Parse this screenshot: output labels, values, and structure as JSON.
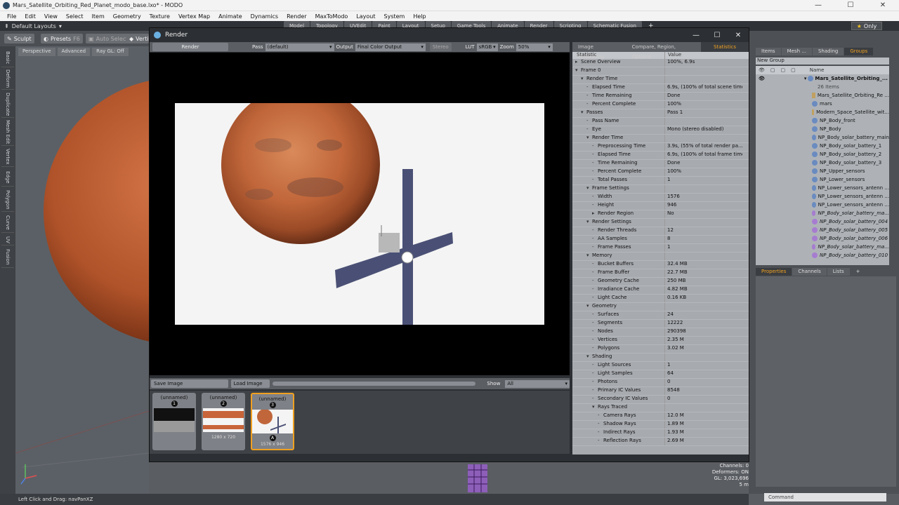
{
  "window": {
    "title": "Mars_Satellite_Orbiting_Red_Planet_modo_base.lxo* - MODO"
  },
  "menu": [
    "File",
    "Edit",
    "View",
    "Select",
    "Item",
    "Geometry",
    "Texture",
    "Vertex Map",
    "Animate",
    "Dynamics",
    "Render",
    "MaxToModo",
    "Layout",
    "System",
    "Help"
  ],
  "layout": {
    "selector": "Default Layouts",
    "tabs": [
      "Model",
      "Topology",
      "UVEdit",
      "Paint",
      "Layout",
      "Setup",
      "Game Tools",
      "Animate",
      "Render",
      "Scripting",
      "Schematic Fusion"
    ],
    "add": "+",
    "only": "Only"
  },
  "toolrow": {
    "sculpt": "Sculpt",
    "presets": "Presets",
    "presets_key": "F6",
    "auto_select": "Auto Select",
    "verts": "Verti"
  },
  "viewport": {
    "tabs": [
      "Perspective",
      "Advanced",
      "Ray GL: Off"
    ]
  },
  "left_tabs": [
    "Basic",
    "Deform",
    "Duplicate",
    "Mesh Edit",
    "Vertex",
    "Edge",
    "Polygon",
    "Curve",
    "UV",
    "Fusion"
  ],
  "render_window": {
    "title": "Render",
    "render_button": "Render",
    "pass_label": "Pass",
    "pass_value": "(default)",
    "output_label": "Output",
    "output_value": "Final Color Output",
    "stereo": "Stereo",
    "lut_label": "LUT",
    "lut_value": "sRGB",
    "zoom_label": "Zoom",
    "zoom_value": "50%",
    "save_image": "Save Image",
    "load_image": "Load Image",
    "show_label": "Show",
    "show_value": "All",
    "thumbs": [
      {
        "name": "(unnamed)",
        "num": "1",
        "size": ""
      },
      {
        "name": "(unnamed)",
        "num": "2",
        "size": "1280 x 720"
      },
      {
        "name": "(unnamed)",
        "num": "3",
        "size": "1576 x 946",
        "badge": "A"
      }
    ]
  },
  "stats": {
    "tabs": [
      "Image Processing",
      "Compare, Region, Options",
      "Statistics"
    ],
    "headers": [
      "Statistic",
      "Value"
    ],
    "rows": [
      {
        "k": "Scene Overview",
        "v": "100%, 6.9s",
        "lvl": 0,
        "arr": "▸"
      },
      {
        "k": "Frame 0",
        "v": "",
        "lvl": 0,
        "arr": "▾"
      },
      {
        "k": "Render Time",
        "v": "",
        "lvl": 1,
        "arr": "▾"
      },
      {
        "k": "Elapsed Time",
        "v": "6.9s, (100% of total scene time)",
        "lvl": 2,
        "arr": "-"
      },
      {
        "k": "Time Remaining",
        "v": "Done",
        "lvl": 2,
        "arr": "-"
      },
      {
        "k": "Percent Complete",
        "v": "100%",
        "lvl": 2,
        "arr": "-"
      },
      {
        "k": "Passes",
        "v": "Pass 1",
        "lvl": 1,
        "arr": "▾"
      },
      {
        "k": "Pass Name",
        "v": "",
        "lvl": 2,
        "arr": "-"
      },
      {
        "k": "Eye",
        "v": "Mono (stereo disabled)",
        "lvl": 2,
        "arr": "-"
      },
      {
        "k": "Render Time",
        "v": "",
        "lvl": 2,
        "arr": "▾"
      },
      {
        "k": "Preprocessing Time",
        "v": "3.9s, (55% of total render pa...",
        "lvl": 3,
        "arr": "-"
      },
      {
        "k": "Elapsed Time",
        "v": "6.9s, (100% of total frame time)",
        "lvl": 3,
        "arr": "-"
      },
      {
        "k": "Time Remaining",
        "v": "Done",
        "lvl": 3,
        "arr": "-"
      },
      {
        "k": "Percent Complete",
        "v": "100%",
        "lvl": 3,
        "arr": "-"
      },
      {
        "k": "Total Passes",
        "v": "1",
        "lvl": 3,
        "arr": "-"
      },
      {
        "k": "Frame Settings",
        "v": "",
        "lvl": 2,
        "arr": "▾"
      },
      {
        "k": "Width",
        "v": "1576",
        "lvl": 3,
        "arr": "-"
      },
      {
        "k": "Height",
        "v": "946",
        "lvl": 3,
        "arr": "-"
      },
      {
        "k": "Render Region",
        "v": "No",
        "lvl": 3,
        "arr": "▸"
      },
      {
        "k": "Render Settings",
        "v": "",
        "lvl": 2,
        "arr": "▾"
      },
      {
        "k": "Render Threads",
        "v": "12",
        "lvl": 3,
        "arr": "-"
      },
      {
        "k": "AA Samples",
        "v": "8",
        "lvl": 3,
        "arr": "-"
      },
      {
        "k": "Frame Passes",
        "v": "1",
        "lvl": 3,
        "arr": "-"
      },
      {
        "k": "Memory",
        "v": "",
        "lvl": 2,
        "arr": "▾"
      },
      {
        "k": "Bucket Buffers",
        "v": "32.4 MB",
        "lvl": 3,
        "arr": "-"
      },
      {
        "k": "Frame Buffer",
        "v": "22.7 MB",
        "lvl": 3,
        "arr": "-"
      },
      {
        "k": "Geometry Cache",
        "v": "250 MB",
        "lvl": 3,
        "arr": "-"
      },
      {
        "k": "Irradiance Cache",
        "v": "4.82 MB",
        "lvl": 3,
        "arr": "-"
      },
      {
        "k": "Light Cache",
        "v": "0.16 KB",
        "lvl": 3,
        "arr": "-"
      },
      {
        "k": "Geometry",
        "v": "",
        "lvl": 2,
        "arr": "▾"
      },
      {
        "k": "Surfaces",
        "v": "24",
        "lvl": 3,
        "arr": "-"
      },
      {
        "k": "Segments",
        "v": "12222",
        "lvl": 3,
        "arr": "-"
      },
      {
        "k": "Nodes",
        "v": "290398",
        "lvl": 3,
        "arr": "-"
      },
      {
        "k": "Vertices",
        "v": "2.35 M",
        "lvl": 3,
        "arr": "-"
      },
      {
        "k": "Polygons",
        "v": "3.02 M",
        "lvl": 3,
        "arr": "-"
      },
      {
        "k": "Shading",
        "v": "",
        "lvl": 2,
        "arr": "▾"
      },
      {
        "k": "Light Sources",
        "v": "1",
        "lvl": 3,
        "arr": "-"
      },
      {
        "k": "Light Samples",
        "v": "64",
        "lvl": 3,
        "arr": "-"
      },
      {
        "k": "Photons",
        "v": "0",
        "lvl": 3,
        "arr": "-"
      },
      {
        "k": "Primary IC Values",
        "v": "8548",
        "lvl": 3,
        "arr": "-"
      },
      {
        "k": "Secondary IC Values",
        "v": "0",
        "lvl": 3,
        "arr": "-"
      },
      {
        "k": "Rays Traced",
        "v": "",
        "lvl": 3,
        "arr": "▾"
      },
      {
        "k": "Camera Rays",
        "v": "12.0 M",
        "lvl": 4,
        "arr": "-"
      },
      {
        "k": "Shadow Rays",
        "v": "1.89 M",
        "lvl": 4,
        "arr": "-"
      },
      {
        "k": "Indirect Rays",
        "v": "1.93 M",
        "lvl": 4,
        "arr": "-"
      },
      {
        "k": "Reflection Rays",
        "v": "2.69 M",
        "lvl": 4,
        "arr": "-"
      }
    ]
  },
  "right": {
    "tabs": [
      "Items",
      "Mesh ...",
      "Shading",
      "Groups"
    ],
    "new_group": "New Group",
    "name_header": "Name",
    "root": "Mars_Satellite_Orbiting_...",
    "root_count": "26 Items",
    "items": [
      {
        "n": "Mars_Satellite_Orbiting_Re ...",
        "t": "loc"
      },
      {
        "n": "mars",
        "t": "mesh"
      },
      {
        "n": "Modern_Space_Satellite_wit...",
        "t": "loc"
      },
      {
        "n": "NP_Body_front",
        "t": "mesh"
      },
      {
        "n": "NP_Body",
        "t": "mesh"
      },
      {
        "n": "NP_Body_solar_battery_main",
        "t": "mesh"
      },
      {
        "n": "NP_Body_solar_battery_1",
        "t": "mesh"
      },
      {
        "n": "NP_Body_solar_battery_2",
        "t": "mesh"
      },
      {
        "n": "NP_Body_solar_battery_3",
        "t": "mesh"
      },
      {
        "n": "NP_Upper_sensors",
        "t": "mesh"
      },
      {
        "n": "NP_Lower_sensors",
        "t": "mesh"
      },
      {
        "n": "NP_Lower_sensors_antenn ...",
        "t": "mesh"
      },
      {
        "n": "NP_Lower_sensors_antenn ...",
        "t": "mesh"
      },
      {
        "n": "NP_Lower_sensors_antenn ...",
        "t": "mesh"
      },
      {
        "n": "NP_Body_solar_battery_ma...",
        "t": "inst"
      },
      {
        "n": "NP_Body_solar_battery_004",
        "t": "inst"
      },
      {
        "n": "NP_Body_solar_battery_005",
        "t": "inst"
      },
      {
        "n": "NP_Body_solar_battery_006",
        "t": "inst"
      },
      {
        "n": "NP_Body_solar_battery_ma...",
        "t": "inst"
      },
      {
        "n": "NP_Body_solar_battery_010",
        "t": "inst"
      }
    ],
    "prop_tabs": [
      "Properties",
      "Channels",
      "Lists"
    ],
    "prop_add": "+",
    "command_placeholder": "Command"
  },
  "status": {
    "hint": "Left Click and Drag:  navPanXZ",
    "channels": "Channels: 0",
    "deformers": "Deformers: ON",
    "gl": "GL: 3,023,696",
    "dist": "5 m"
  },
  "colors": {
    "accent": "#f0a020",
    "mars": "#c8643a"
  }
}
